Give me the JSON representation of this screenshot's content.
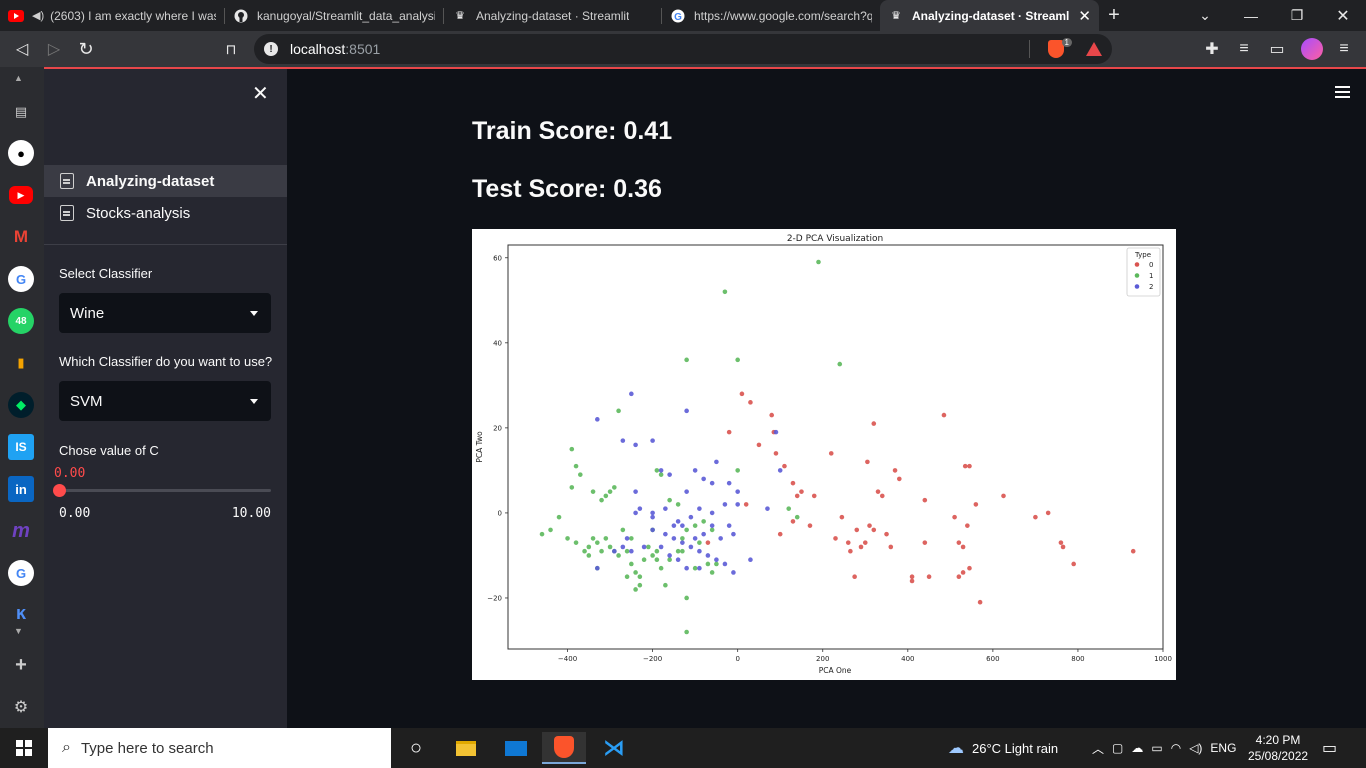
{
  "browser": {
    "tabs": [
      {
        "title": "(2603) I am exactly where I was",
        "icon": "youtube-icon",
        "active": false
      },
      {
        "title": "kanugoyal/Streamlit_data_analysis",
        "icon": "github-icon",
        "active": false
      },
      {
        "title": "Analyzing-dataset · Streamlit",
        "icon": "streamlit-crown-icon",
        "active": false
      },
      {
        "title": "https://www.google.com/search?q",
        "icon": "google-icon",
        "active": false
      },
      {
        "title": "Analyzing-dataset · Streamlit",
        "icon": "streamlit-crown-icon",
        "active": true
      }
    ],
    "url_host": "localhost",
    "url_port": ":8501",
    "brave_badge": "1"
  },
  "sidebar": {
    "nav": [
      {
        "label": "Analyzing-dataset",
        "active": true
      },
      {
        "label": "Stocks-analysis",
        "active": false
      }
    ],
    "dataset_label": "Select Classifier",
    "dataset_value": "Wine",
    "classifier_label": "Which Classifier do you want to use?",
    "classifier_value": "SVM",
    "c_label": "Chose value of C",
    "c_value": "0.00",
    "c_min": "0.00",
    "c_max": "10.00",
    "c_fraction": 0.0
  },
  "main": {
    "train_score": "Train Score: 0.41",
    "test_score": "Test Score: 0.36"
  },
  "chart_data": {
    "type": "scatter",
    "title": "2-D PCA Visualization",
    "xlabel": "PCA One",
    "ylabel": "PCA Two",
    "xlim": [
      -540,
      1000
    ],
    "ylim": [
      -32,
      63
    ],
    "xticks": [
      -400,
      -200,
      0,
      200,
      400,
      600,
      800,
      1000
    ],
    "yticks": [
      -20,
      0,
      20,
      40,
      60
    ],
    "legend_title": "Type",
    "legend_position": "top-right",
    "series": [
      {
        "name": "0",
        "color": "#d9534f",
        "points": [
          [
            10,
            28
          ],
          [
            30,
            26
          ],
          [
            -20,
            19
          ],
          [
            80,
            23
          ],
          [
            50,
            16
          ],
          [
            85,
            19
          ],
          [
            90,
            14
          ],
          [
            110,
            11
          ],
          [
            150,
            5
          ],
          [
            180,
            4
          ],
          [
            130,
            7
          ],
          [
            140,
            4
          ],
          [
            100,
            -5
          ],
          [
            130,
            -2
          ],
          [
            170,
            -3
          ],
          [
            220,
            14
          ],
          [
            245,
            -1
          ],
          [
            260,
            -7
          ],
          [
            280,
            -4
          ],
          [
            290,
            -8
          ],
          [
            300,
            -7
          ],
          [
            310,
            -3
          ],
          [
            320,
            -4
          ],
          [
            305,
            12
          ],
          [
            320,
            21
          ],
          [
            330,
            5
          ],
          [
            340,
            4
          ],
          [
            350,
            -5
          ],
          [
            360,
            -8
          ],
          [
            370,
            10
          ],
          [
            380,
            8
          ],
          [
            410,
            -15
          ],
          [
            410,
            -16
          ],
          [
            440,
            3
          ],
          [
            440,
            -7
          ],
          [
            450,
            -15
          ],
          [
            485,
            23
          ],
          [
            510,
            -1
          ],
          [
            520,
            -7
          ],
          [
            520,
            -15
          ],
          [
            530,
            -14
          ],
          [
            530,
            -8
          ],
          [
            535,
            11
          ],
          [
            540,
            -3
          ],
          [
            545,
            -13
          ],
          [
            545,
            11
          ],
          [
            560,
            2
          ],
          [
            570,
            -21
          ],
          [
            625,
            4
          ],
          [
            700,
            -1
          ],
          [
            730,
            0
          ],
          [
            760,
            -7
          ],
          [
            765,
            -8
          ],
          [
            790,
            -12
          ],
          [
            930,
            -9
          ],
          [
            275,
            -15
          ],
          [
            265,
            -9
          ],
          [
            230,
            -6
          ],
          [
            20,
            2
          ],
          [
            -70,
            -7
          ]
        ]
      },
      {
        "name": "1",
        "color": "#5cb85c",
        "points": [
          [
            190,
            59
          ],
          [
            -30,
            52
          ],
          [
            0,
            36
          ],
          [
            240,
            35
          ],
          [
            -120,
            36
          ],
          [
            -280,
            24
          ],
          [
            -390,
            15
          ],
          [
            -380,
            11
          ],
          [
            -370,
            9
          ],
          [
            -390,
            6
          ],
          [
            -340,
            5
          ],
          [
            -310,
            4
          ],
          [
            -300,
            5
          ],
          [
            -320,
            3
          ],
          [
            -290,
            6
          ],
          [
            -420,
            -1
          ],
          [
            -440,
            -4
          ],
          [
            -460,
            -5
          ],
          [
            -400,
            -6
          ],
          [
            -380,
            -7
          ],
          [
            -360,
            -9
          ],
          [
            -350,
            -8
          ],
          [
            -340,
            -6
          ],
          [
            -330,
            -7
          ],
          [
            -320,
            -9
          ],
          [
            -300,
            -8
          ],
          [
            -290,
            -9
          ],
          [
            -280,
            -10
          ],
          [
            -260,
            -9
          ],
          [
            -250,
            -12
          ],
          [
            -240,
            -14
          ],
          [
            -230,
            -15
          ],
          [
            -230,
            -17
          ],
          [
            -240,
            -18
          ],
          [
            -260,
            -15
          ],
          [
            -210,
            -8
          ],
          [
            -190,
            -9
          ],
          [
            -180,
            -13
          ],
          [
            -160,
            -11
          ],
          [
            -140,
            -9
          ],
          [
            -130,
            -6
          ],
          [
            -120,
            -4
          ],
          [
            -100,
            -3
          ],
          [
            -80,
            -2
          ],
          [
            -60,
            -4
          ],
          [
            -70,
            -12
          ],
          [
            -60,
            -14
          ],
          [
            -50,
            -12
          ],
          [
            -140,
            2
          ],
          [
            -160,
            3
          ],
          [
            -190,
            10
          ],
          [
            -180,
            9
          ],
          [
            -120,
            -20
          ],
          [
            -120,
            -28
          ],
          [
            -170,
            -17
          ],
          [
            -200,
            -4
          ],
          [
            -130,
            -9
          ],
          [
            -90,
            -7
          ],
          [
            0,
            10
          ],
          [
            120,
            1
          ],
          [
            140,
            -1
          ],
          [
            -310,
            -6
          ],
          [
            -270,
            -4
          ],
          [
            -250,
            -6
          ],
          [
            -220,
            -11
          ],
          [
            -200,
            -10
          ],
          [
            -100,
            -13
          ],
          [
            -190,
            -11
          ],
          [
            -330,
            -13
          ],
          [
            -350,
            -10
          ]
        ]
      },
      {
        "name": "2",
        "color": "#5b5bd6",
        "points": [
          [
            -330,
            22
          ],
          [
            -250,
            28
          ],
          [
            -120,
            24
          ],
          [
            -270,
            17
          ],
          [
            -240,
            16
          ],
          [
            -200,
            17
          ],
          [
            -180,
            10
          ],
          [
            -160,
            9
          ],
          [
            -100,
            10
          ],
          [
            -120,
            5
          ],
          [
            -80,
            8
          ],
          [
            -60,
            7
          ],
          [
            -50,
            12
          ],
          [
            -20,
            7
          ],
          [
            0,
            5
          ],
          [
            0,
            2
          ],
          [
            -30,
            2
          ],
          [
            -60,
            0
          ],
          [
            -90,
            1
          ],
          [
            -110,
            -1
          ],
          [
            -140,
            -2
          ],
          [
            -170,
            1
          ],
          [
            -200,
            -1
          ],
          [
            -230,
            1
          ],
          [
            -240,
            0
          ],
          [
            -200,
            -4
          ],
          [
            -150,
            -6
          ],
          [
            -130,
            -7
          ],
          [
            -110,
            -8
          ],
          [
            -90,
            -9
          ],
          [
            -70,
            -10
          ],
          [
            -50,
            -11
          ],
          [
            -30,
            -12
          ],
          [
            -10,
            -14
          ],
          [
            -120,
            -13
          ],
          [
            -90,
            -13
          ],
          [
            -260,
            -6
          ],
          [
            -250,
            -9
          ],
          [
            -220,
            -8
          ],
          [
            -240,
            5
          ],
          [
            -270,
            -8
          ],
          [
            -290,
            -9
          ],
          [
            -180,
            -8
          ],
          [
            -160,
            -10
          ],
          [
            -140,
            -11
          ],
          [
            -330,
            -13
          ],
          [
            90,
            19
          ],
          [
            100,
            10
          ],
          [
            70,
            1
          ],
          [
            30,
            -11
          ],
          [
            -10,
            -5
          ],
          [
            -40,
            -6
          ],
          [
            -60,
            -3
          ],
          [
            -80,
            -5
          ],
          [
            -20,
            -3
          ],
          [
            -200,
            0
          ],
          [
            -130,
            -3
          ],
          [
            -100,
            -6
          ],
          [
            -170,
            -5
          ],
          [
            -150,
            -3
          ]
        ]
      }
    ]
  }
}
